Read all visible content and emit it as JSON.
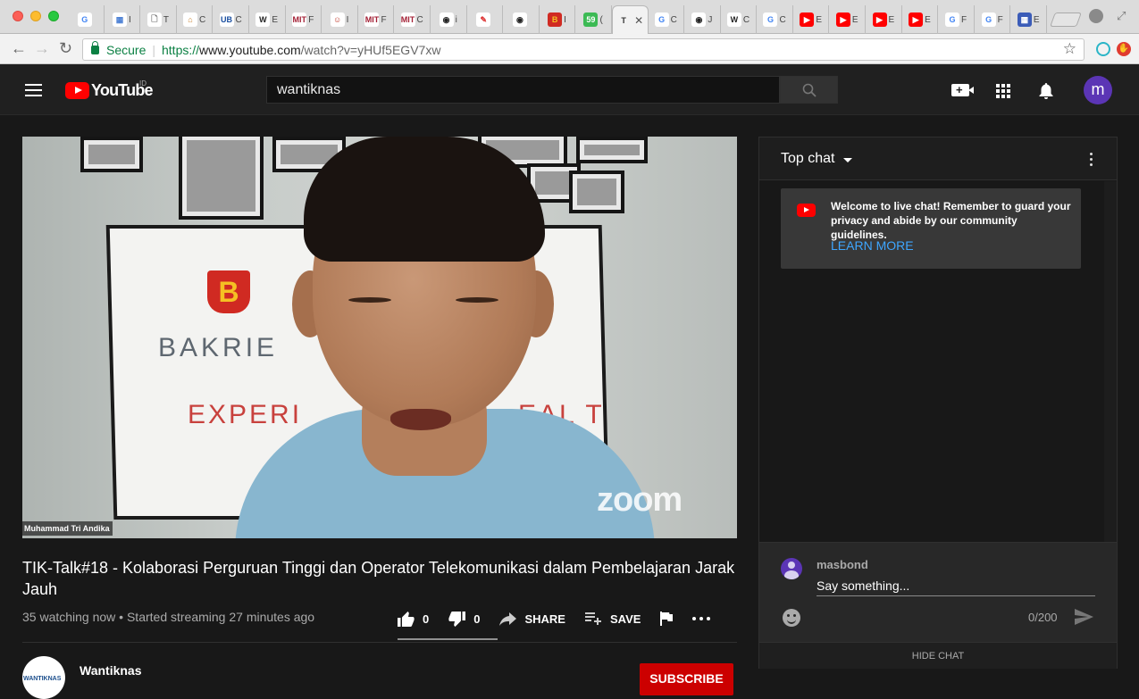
{
  "browser": {
    "tabs": [
      {
        "icon": "G",
        "label": "",
        "color": "#4285f4",
        "bg": "#fff"
      },
      {
        "icon": "▦",
        "label": "I",
        "color": "#4a7fd4",
        "bg": "#fff"
      },
      {
        "icon": "🗋",
        "label": "T",
        "color": "#666",
        "bg": "#fff"
      },
      {
        "icon": "⌂",
        "label": "C",
        "color": "#c8822d",
        "bg": "#fff"
      },
      {
        "icon": "UB",
        "label": "C",
        "color": "#1a4fa0",
        "bg": "#fff"
      },
      {
        "icon": "W",
        "label": "E",
        "color": "#222",
        "bg": "#fff"
      },
      {
        "icon": "MIT",
        "label": "F",
        "color": "#a31f34",
        "bg": "#fff"
      },
      {
        "icon": "☺",
        "label": "I",
        "color": "#c0392b",
        "bg": "#fff"
      },
      {
        "icon": "MIT",
        "label": "F",
        "color": "#a31f34",
        "bg": "#fff"
      },
      {
        "icon": "MIT",
        "label": "C",
        "color": "#a31f34",
        "bg": "#fff"
      },
      {
        "icon": "◉",
        "label": "i",
        "color": "#222",
        "bg": "#fff"
      },
      {
        "icon": "✎",
        "label": "",
        "color": "#d33",
        "bg": "#fff"
      },
      {
        "icon": "◉",
        "label": "",
        "color": "#222",
        "bg": "#fff"
      },
      {
        "icon": "B",
        "label": "I",
        "color": "#f5c023",
        "bg": "#d02a22"
      },
      {
        "icon": "59",
        "label": "(",
        "color": "#fff",
        "bg": "#3cba54"
      },
      {
        "icon": "T",
        "label": "",
        "color": "#333",
        "bg": "#f2f2f2",
        "active": true
      },
      {
        "icon": "G",
        "label": "C",
        "color": "#4285f4",
        "bg": "#fff"
      },
      {
        "icon": "◉",
        "label": "J",
        "color": "#222",
        "bg": "#fff"
      },
      {
        "icon": "W",
        "label": "C",
        "color": "#222",
        "bg": "#fff"
      },
      {
        "icon": "G",
        "label": "C",
        "color": "#4285f4",
        "bg": "#fff"
      },
      {
        "icon": "▶",
        "label": "E",
        "color": "#fff",
        "bg": "#ff0000"
      },
      {
        "icon": "▶",
        "label": "E",
        "color": "#fff",
        "bg": "#ff0000"
      },
      {
        "icon": "▶",
        "label": "E",
        "color": "#fff",
        "bg": "#ff0000"
      },
      {
        "icon": "▶",
        "label": "E",
        "color": "#fff",
        "bg": "#ff0000"
      },
      {
        "icon": "G",
        "label": "F",
        "color": "#4285f4",
        "bg": "#fff"
      },
      {
        "icon": "G",
        "label": "F",
        "color": "#4285f4",
        "bg": "#fff"
      },
      {
        "icon": "▦",
        "label": "E",
        "color": "#fff",
        "bg": "#3b5cb8"
      }
    ],
    "active_tab_close": "✕",
    "secure_label": "Secure",
    "url_scheme": "https://",
    "url_host": "www.youtube.com",
    "url_path": "/watch?v=yHUf5EGV7xw"
  },
  "header": {
    "logo_text": "YouTube",
    "region": "ID",
    "search_value": "wantiknas",
    "avatar_letter": "m"
  },
  "video": {
    "presenter_label": "Muhammad Tri Andika",
    "watermark": "zoom",
    "banner_text1": "BAKRIE",
    "banner_text2": "EXPERI",
    "banner_text3": "EAL T",
    "banner_logo": "B",
    "title": "TIK-Talk#18 - Kolaborasi Perguruan Tinggi dan Operator Telekomunikasi dalam Pembelajaran Jarak Jauh",
    "view_info": "35 watching now • Started streaming 27 minutes ago",
    "likes": "0",
    "dislikes": "0",
    "share_label": "SHARE",
    "save_label": "SAVE",
    "channel_name": "Wantiknas",
    "channel_avatar_text": "WANTIKNAS",
    "subscribe_label": "SUBSCRIBE"
  },
  "chat": {
    "mode_label": "Top chat",
    "welcome_text": "Welcome to live chat! Remember to guard your privacy and abide by our community guidelines.",
    "learn_more": "LEARN MORE",
    "username": "masbond",
    "input_placeholder": "Say something...",
    "char_count": "0/200",
    "hide_chat": "HIDE CHAT"
  },
  "colors": {
    "brand_red": "#ff0000",
    "link_blue": "#3ea6ff",
    "subscribe_red": "#cc0000",
    "background": "#181818"
  }
}
